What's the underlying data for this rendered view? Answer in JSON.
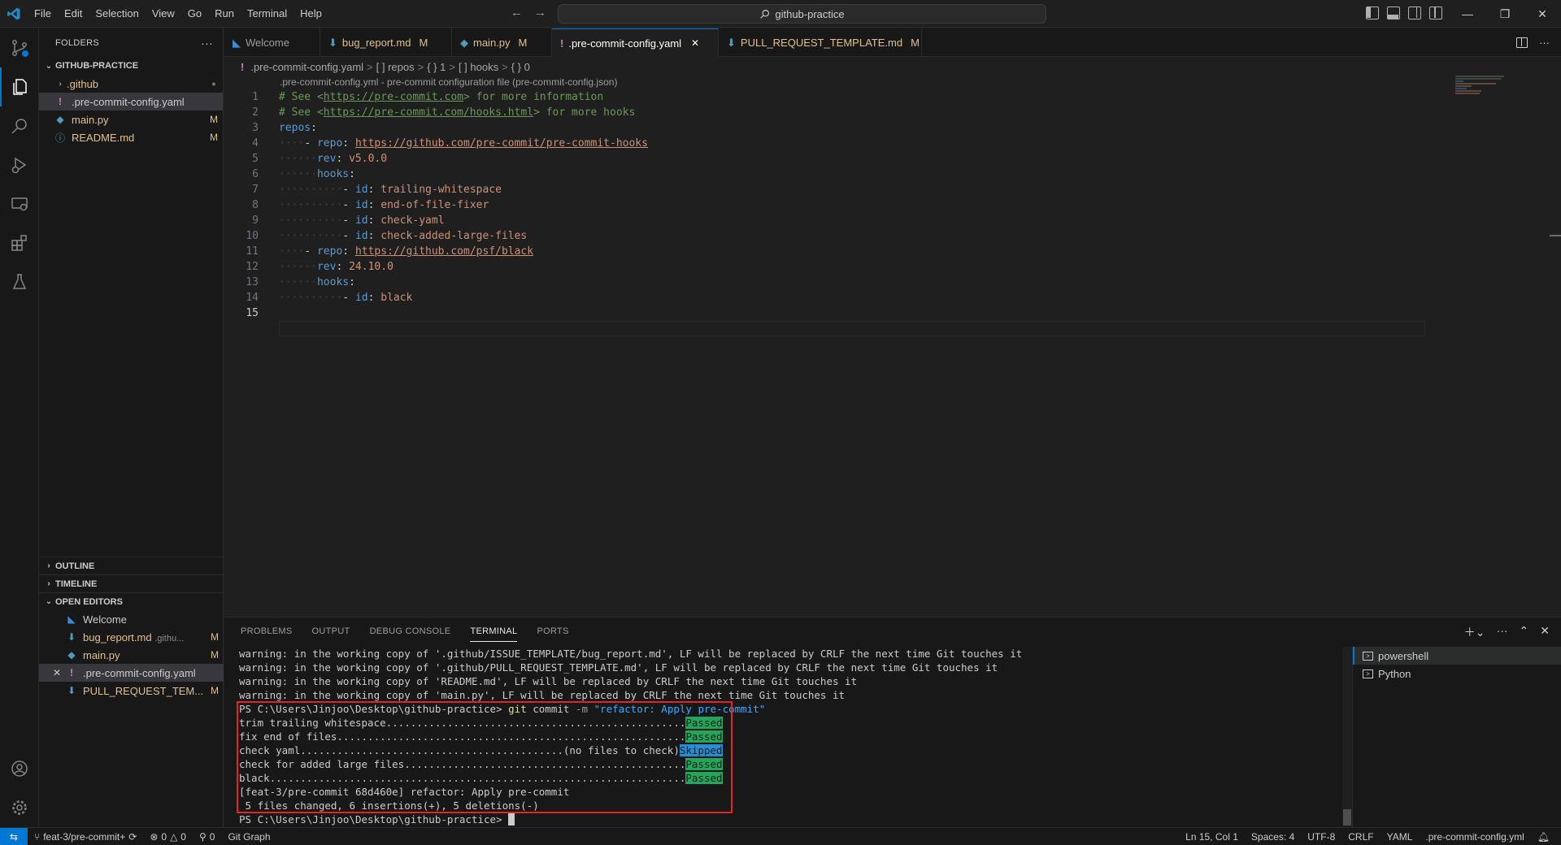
{
  "menu": [
    "File",
    "Edit",
    "Selection",
    "View",
    "Go",
    "Run",
    "Terminal",
    "Help"
  ],
  "search": {
    "text": "github-practice"
  },
  "explorer": {
    "header": "FOLDERS",
    "root": "GITHUB-PRACTICE",
    "items": [
      {
        "name": ".github",
        "badge": "●",
        "type": "folder"
      },
      {
        "name": ".pre-commit-config.yaml",
        "badge": "",
        "type": "yaml"
      },
      {
        "name": "main.py",
        "badge": "M",
        "type": "python"
      },
      {
        "name": "README.md",
        "badge": "M",
        "type": "info"
      }
    ],
    "outline": "OUTLINE",
    "timeline": "TIMELINE",
    "open_editors": "OPEN EDITORS",
    "open_items": [
      {
        "name": "Welcome",
        "extra": "",
        "badge": ""
      },
      {
        "name": "bug_report.md",
        "extra": ".githu...",
        "badge": "M"
      },
      {
        "name": "main.py",
        "extra": "",
        "badge": "M"
      },
      {
        "name": ".pre-commit-config.yaml",
        "extra": "",
        "badge": ""
      },
      {
        "name": "PULL_REQUEST_TEM...",
        "extra": "",
        "badge": "M"
      }
    ]
  },
  "tabs": [
    {
      "label": "Welcome",
      "mod": ""
    },
    {
      "label": "bug_report.md",
      "mod": "M"
    },
    {
      "label": "main.py",
      "mod": "M"
    },
    {
      "label": ".pre-commit-config.yaml",
      "mod": ""
    },
    {
      "label": "PULL_REQUEST_TEMPLATE.md",
      "mod": "M"
    }
  ],
  "breadcrumb": [
    ".pre-commit-config.yaml",
    "[ ] repos",
    "{ } 1",
    "[ ] hooks",
    "{ } 0"
  ],
  "editor": {
    "schema_hint": ".pre-commit-config.yml - pre-commit configuration file (pre-commit-config.json)",
    "line_numbers": [
      "1",
      "2",
      "3",
      "4",
      "5",
      "6",
      "7",
      "8",
      "9",
      "10",
      "11",
      "12",
      "13",
      "14",
      "15"
    ],
    "line1": {
      "a": "# See <",
      "link": "https://pre-commit.com",
      "b": "> for more information"
    },
    "line2": {
      "a": "# See <",
      "link": "https://pre-commit.com/hooks.html",
      "b": "> for more hooks"
    },
    "repos_key": "repos",
    "repo_key": "repo",
    "rev_key": "rev",
    "hooks_key": "hooks",
    "id_key": "id",
    "repo1_url": "https://github.com/pre-commit/pre-commit-hooks",
    "repo1_rev": "v5.0.0",
    "repo1_hooks": [
      "trailing-whitespace",
      "end-of-file-fixer",
      "check-yaml",
      "check-added-large-files"
    ],
    "repo2_url": "https://github.com/psf/black",
    "repo2_rev": "24.10.0",
    "repo2_hooks": [
      "black"
    ]
  },
  "panel": {
    "tabs": [
      "PROBLEMS",
      "OUTPUT",
      "DEBUG CONSOLE",
      "TERMINAL",
      "PORTS"
    ],
    "terminals": [
      "powershell",
      "Python"
    ]
  },
  "terminal": {
    "warnings": [
      "warning: in the working copy of '.github/ISSUE_TEMPLATE/bug_report.md', LF will be replaced by CRLF the next time Git touches it",
      "warning: in the working copy of '.github/PULL_REQUEST_TEMPLATE.md', LF will be replaced by CRLF the next time Git touches it",
      "warning: in the working copy of 'README.md', LF will be replaced by CRLF the next time Git touches it",
      "warning: in the working copy of 'main.py', LF will be replaced by CRLF the next time Git touches it"
    ],
    "prompt": "PS C:\\Users\\Jinjoo\\Desktop\\github-practice> ",
    "cmd": "git",
    "cmd_rest": " commit ",
    "flag": "-m",
    "msg": " \"refactor: Apply pre-commit\"",
    "checks": [
      {
        "text": "trim trailing whitespace.................................................",
        "result": "Passed",
        "kind": "passed"
      },
      {
        "text": "fix end of files.........................................................",
        "result": "Passed",
        "kind": "passed"
      },
      {
        "text": "check yaml...........................................(no files to check)",
        "result": "Skipped",
        "kind": "skipped"
      },
      {
        "text": "check for added large files..............................................",
        "result": "Passed",
        "kind": "passed"
      },
      {
        "text": "black....................................................................",
        "result": "Passed",
        "kind": "passed"
      }
    ],
    "commit_line": "[feat-3/pre-commit 68d460e] refactor: Apply pre-commit",
    "summary_line": " 5 files changed, 6 insertions(+), 5 deletions(-)",
    "final_prompt": "PS C:\\Users\\Jinjoo\\Desktop\\github-practice> "
  },
  "status": {
    "branch": "feat-3/pre-commit+",
    "errors": "0",
    "warnings": "0",
    "ports": "0",
    "git_graph": "Git Graph",
    "position": "Ln 15, Col 1",
    "spaces": "Spaces: 4",
    "encoding": "UTF-8",
    "eol": "CRLF",
    "language": "YAML",
    "schema": ".pre-commit-config.yml"
  },
  "colors": {
    "accent": "#0078d4",
    "passed": "#23a55a",
    "skipped": "#2a8bd1",
    "highlight": "#e8202a"
  }
}
